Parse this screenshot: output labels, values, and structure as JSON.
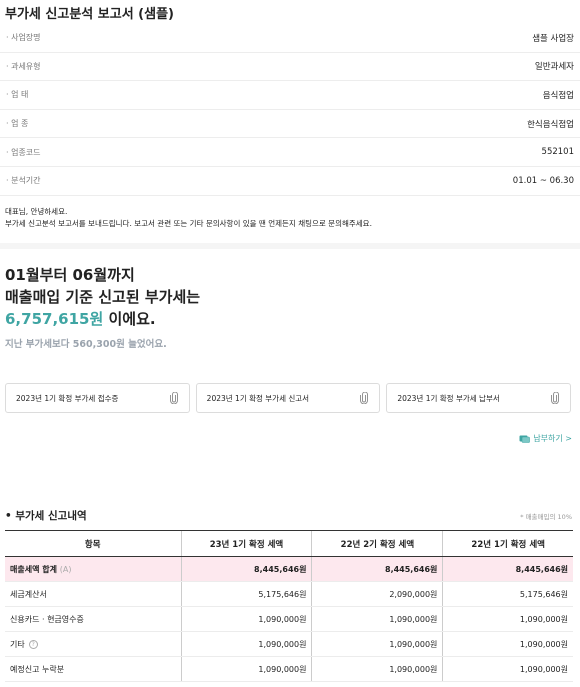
{
  "report": {
    "title": "부가세 신고분석 보고서 (샘플)"
  },
  "info": [
    {
      "key": "· 사업장명",
      "value": "샘플 사업장"
    },
    {
      "key": "· 과세유형",
      "value": "일반과세자"
    },
    {
      "key": "· 업 태",
      "value": "음식점업"
    },
    {
      "key": "· 업 종",
      "value": "한식음식점업"
    },
    {
      "key": "· 업종코드",
      "value": "552101"
    },
    {
      "key": "· 분석기간",
      "value": "01.01 ~ 06.30"
    }
  ],
  "greeting": {
    "line1": "대표님, 안녕하세요.",
    "line2": "부가세 신고분석 보고서를 보내드립니다. 보고서 관련 또는 기타 문의사항이 있을 땐 언제든지 채팅으로 문의해주세요."
  },
  "summary": {
    "line1": "01월부터 06월까지",
    "line2": "매출매입 기준 신고된 부가세는",
    "amount": "6,757,615원",
    "amount_suffix": " 이에요.",
    "diff": "지난 부가세보다 560,300원 늘었어요."
  },
  "documents": [
    {
      "label": "2023년 1기 확정 부가세 접수증",
      "icon": "paperclip-icon"
    },
    {
      "label": "2023년 1기 확정 부가세 신고서",
      "icon": "paperclip-icon"
    },
    {
      "label": "2023년 1기 확정 부가세 납부서",
      "icon": "paperclip-icon"
    }
  ],
  "pay_link": {
    "label": "납부하기 >",
    "icon": "card-icon"
  },
  "history": {
    "title": "• 부가세 신고내역",
    "note": "* 매출매입의 10%",
    "headers": [
      "항목",
      "23년 1기 확정 세액",
      "22년 2기 확정 세액",
      "22년 1기 확정 세액"
    ],
    "rows": [
      {
        "label": "매출세액 합계",
        "sub": "(A)",
        "values": [
          "8,445,646원",
          "8,445,646원",
          "8,445,646원"
        ],
        "total": true
      },
      {
        "label": "세금계산서",
        "values": [
          "5,175,646원",
          "2,090,000원",
          "5,175,646원"
        ]
      },
      {
        "label": "신용카드 · 현금영수증",
        "values": [
          "1,090,000원",
          "1,090,000원",
          "1,090,000원"
        ]
      },
      {
        "label": "기타",
        "help": "?",
        "values": [
          "1,090,000원",
          "1,090,000원",
          "1,090,000원"
        ]
      },
      {
        "label": "예정신고 누락분",
        "values": [
          "1,090,000원",
          "1,090,000원",
          "1,090,000원"
        ]
      }
    ]
  },
  "colors": {
    "accent": "#3fa5a3",
    "total_row": "#fde8ee"
  }
}
